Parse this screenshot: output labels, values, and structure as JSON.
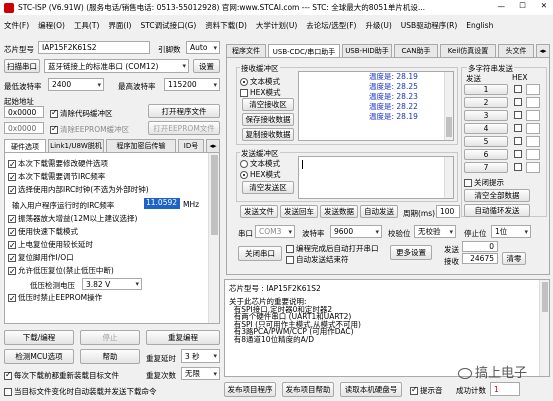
{
  "titlebar": {
    "title": "STC-ISP (V6.91W) (服务电话/销售电话: 0513-55012928) 官网:www.STCAI.com  --- STC: 全球最大的8051单片机设..."
  },
  "menu": [
    "文件(F)",
    "编程(O)",
    "工具(T)",
    "界面(I)",
    "STC调试接口(G)",
    "资料下载(D)",
    "大学计划(U)",
    "去论坛/选型(F)",
    "升级(U)",
    "USB驱动程序(R)",
    "English"
  ],
  "left": {
    "chip_label": "芯片型号",
    "chip_value": "IAP15F2K61S2",
    "pin_label": "引脚数",
    "pin_value": "Auto",
    "scan_button": "扫描串口",
    "port_value": "蓝牙链接上的标准串口 (COM12)",
    "settings_button": "设置",
    "min_baud_label": "最低波特率",
    "min_baud_value": "2400",
    "max_baud_label": "最高波特率",
    "max_baud_value": "115200",
    "start_addr_label": "起始地址",
    "addr1": "0x0000",
    "clear_code_label": "清除代码缓冲区",
    "open_prog_button": "打开程序文件",
    "addr2": "0x0000",
    "clear_eeprom_label": "清除EEPROM缓冲区",
    "open_eeprom_button": "打开EEPROM文件",
    "tabs": [
      "硬件选项",
      "Link1/U8W脱机",
      "程序加密后传输",
      "ID号"
    ],
    "options": [
      {
        "text": "本次下载需要修改硬件选项",
        "checked": true
      },
      {
        "text": "本次下载需要调节IRC频率",
        "checked": true
      },
      {
        "text": "选择使用内部IRC时钟(不选为外部时钟)",
        "checked": true
      }
    ],
    "irc_label": "输入用户程序运行时的IRC频率",
    "irc_value": "11.0592",
    "irc_unit": "MHz",
    "options2": [
      {
        "text": "振荡器放大增益(12M以上建议选择)",
        "checked": true
      },
      {
        "text": "使用快速下载模式",
        "checked": true
      },
      {
        "text": "上电复位使用较长延时",
        "checked": true
      },
      {
        "text": "复位脚用作I/O口",
        "checked": true
      },
      {
        "text": "允许低压复位(禁止低压中断)",
        "checked": true
      }
    ],
    "lvd_label": "低压检测电压",
    "lvd_value": "3.82 V",
    "eeprom_opt": {
      "text": "低压时禁止EEPROM操作",
      "checked": true
    },
    "download_button": "下载/编程",
    "stop_button": "停止",
    "reprogram_button": "重复编程",
    "detect_button": "检测MCU选项",
    "help_button": "帮助",
    "delay_label": "重复延时",
    "delay_value": "3 秒",
    "reload_label": "每次下载前都重新装载目标文件",
    "repeat_label": "重复次数",
    "repeat_value": "无限",
    "auto_load_label": "当目标文件变化时自动装载并发送下载命令"
  },
  "right": {
    "tabs": [
      "程序文件",
      "USB-CDC/串口助手",
      "USB-HID助手",
      "CAN助手",
      "Keil仿真设置",
      "头文件"
    ],
    "recv_group": "接收缓冲区",
    "text_mode": "文本模式",
    "hex_mode": "HEX模式",
    "clear_recv": "清空接收区",
    "save_recv": "保存接收数据",
    "copy_recv": "复制接收数据",
    "temps": [
      "温度是: 28.19",
      "温度是: 28.25",
      "温度是: 28.23",
      "温度是: 28.22",
      "温度是: 28.19"
    ],
    "multi_group": "多字符串发送",
    "multi_send": "发送",
    "multi_hex": "HEX",
    "multi_rows": [
      "1",
      "2",
      "3",
      "4",
      "5",
      "6",
      "7"
    ],
    "close_hint": "关闭提示",
    "clear_all": "清空全部数据",
    "auto_loop": "自动循环发送",
    "send_group": "发送缓冲区",
    "send_text": "文本模式",
    "send_hex": "HEX模式",
    "clear_send": "清空发送区",
    "send_file": "发送文件",
    "send_enter": "发送回车",
    "send_data": "发送数据",
    "auto_send": "自动发送",
    "period_label": "周期(ms)",
    "period_value": "100",
    "port_label": "串口",
    "port_value": "COM3",
    "baud_label": "波特率",
    "baud_value": "9600",
    "parity_label": "校验位",
    "parity_value": "无校验",
    "stop_label": "停止位",
    "stop_value": "1位",
    "close_port": "关闭串口",
    "cb_prog": "编程完成后自动打开串口",
    "cb_end": "自动发送结束符",
    "more_settings": "更多设置",
    "send_count_label": "发送",
    "send_count": "0",
    "recv_count_label": "接收",
    "recv_count": "24675",
    "clear_count": "清零"
  },
  "info": {
    "chip": "芯片型号  : IAP15F2K61S2",
    "lines": [
      "关于此芯片的重要说明:",
      "  有SPI接口,定时器0和定时器2",
      "  有两个硬件串口 (UART1和UART2)",
      "  有SPI (只可用作主模式,从模式不可用)",
      "  有3路PCA/PWM/CCP (可用作DAC)",
      "  有8通道10位精度的A/D"
    ]
  },
  "bottom": {
    "publish_prog": "发布项目程序",
    "publish_help": "发布项目帮助",
    "read_serial": "读取本机硬盘号",
    "beep": "提示音",
    "count_label": "成功计数",
    "count_value": "1",
    "watermark": "搞上电子"
  }
}
